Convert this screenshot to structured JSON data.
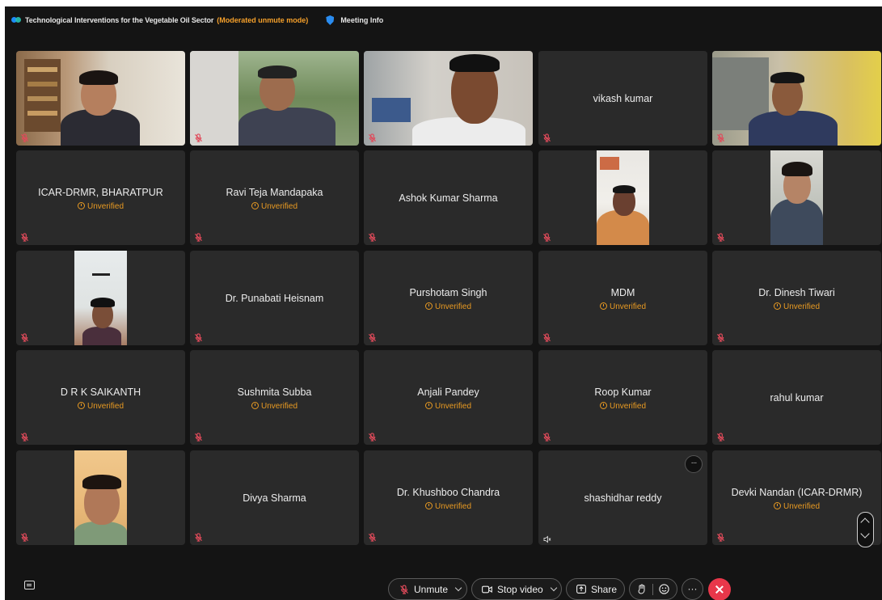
{
  "window": {
    "title": "Technological Interventions for the Vegetable Oil Sector",
    "mode": "(Moderated unmute mode)",
    "meeting_info_label": "Meeting Info"
  },
  "participants": [
    {
      "name": "",
      "video": true,
      "status": "",
      "audio": "muted"
    },
    {
      "name": "",
      "video": true,
      "status": "",
      "audio": "muted"
    },
    {
      "name": "",
      "video": true,
      "status": "",
      "audio": "muted"
    },
    {
      "name": "vikash kumar",
      "video": false,
      "status": "",
      "audio": "muted"
    },
    {
      "name": "",
      "video": true,
      "status": "",
      "audio": "muted"
    },
    {
      "name": "ICAR-DRMR, BHARATPUR",
      "video": false,
      "status": "Unverified",
      "audio": "muted"
    },
    {
      "name": "Ravi Teja Mandapaka",
      "video": false,
      "status": "Unverified",
      "audio": "muted"
    },
    {
      "name": "Ashok Kumar Sharma",
      "video": false,
      "status": "",
      "audio": "muted"
    },
    {
      "name": "",
      "video": true,
      "status": "",
      "audio": "muted"
    },
    {
      "name": "",
      "video": true,
      "status": "",
      "audio": "muted"
    },
    {
      "name": "",
      "video": true,
      "status": "",
      "audio": "muted"
    },
    {
      "name": "Dr. Punabati Heisnam",
      "video": false,
      "status": "",
      "audio": "muted"
    },
    {
      "name": "Purshotam Singh",
      "video": false,
      "status": "Unverified",
      "audio": "muted"
    },
    {
      "name": "MDM",
      "video": false,
      "status": "Unverified",
      "audio": "muted"
    },
    {
      "name": "Dr. Dinesh Tiwari",
      "video": false,
      "status": "Unverified",
      "audio": "muted"
    },
    {
      "name": "D R K SAIKANTH",
      "video": false,
      "status": "Unverified",
      "audio": "muted"
    },
    {
      "name": "Sushmita Subba",
      "video": false,
      "status": "Unverified",
      "audio": "muted"
    },
    {
      "name": "Anjali Pandey",
      "video": false,
      "status": "Unverified",
      "audio": "muted"
    },
    {
      "name": "Roop Kumar",
      "video": false,
      "status": "Unverified",
      "audio": "muted"
    },
    {
      "name": "rahul kumar",
      "video": false,
      "status": "",
      "audio": "muted"
    },
    {
      "name": "",
      "video": true,
      "status": "",
      "audio": "muted"
    },
    {
      "name": "Divya Sharma",
      "video": false,
      "status": "",
      "audio": "muted"
    },
    {
      "name": "Dr. Khushboo Chandra",
      "video": false,
      "status": "Unverified",
      "audio": "muted"
    },
    {
      "name": "shashidhar reddy",
      "video": false,
      "status": "",
      "audio": "speaker"
    },
    {
      "name": "Devki Nandan (ICAR-DRMR)",
      "video": false,
      "status": "Unverified",
      "audio": "muted"
    }
  ],
  "toolbar": {
    "unmute_label": "Unmute",
    "stop_video_label": "Stop video",
    "share_label": "Share",
    "more_label": "···"
  },
  "colors": {
    "background": "#141414",
    "tile": "#2a2a2a",
    "unverified": "#e89a22",
    "mode_accent": "#f7a12b",
    "leave": "#e8374a",
    "muted_mic": "#e04a5a"
  }
}
